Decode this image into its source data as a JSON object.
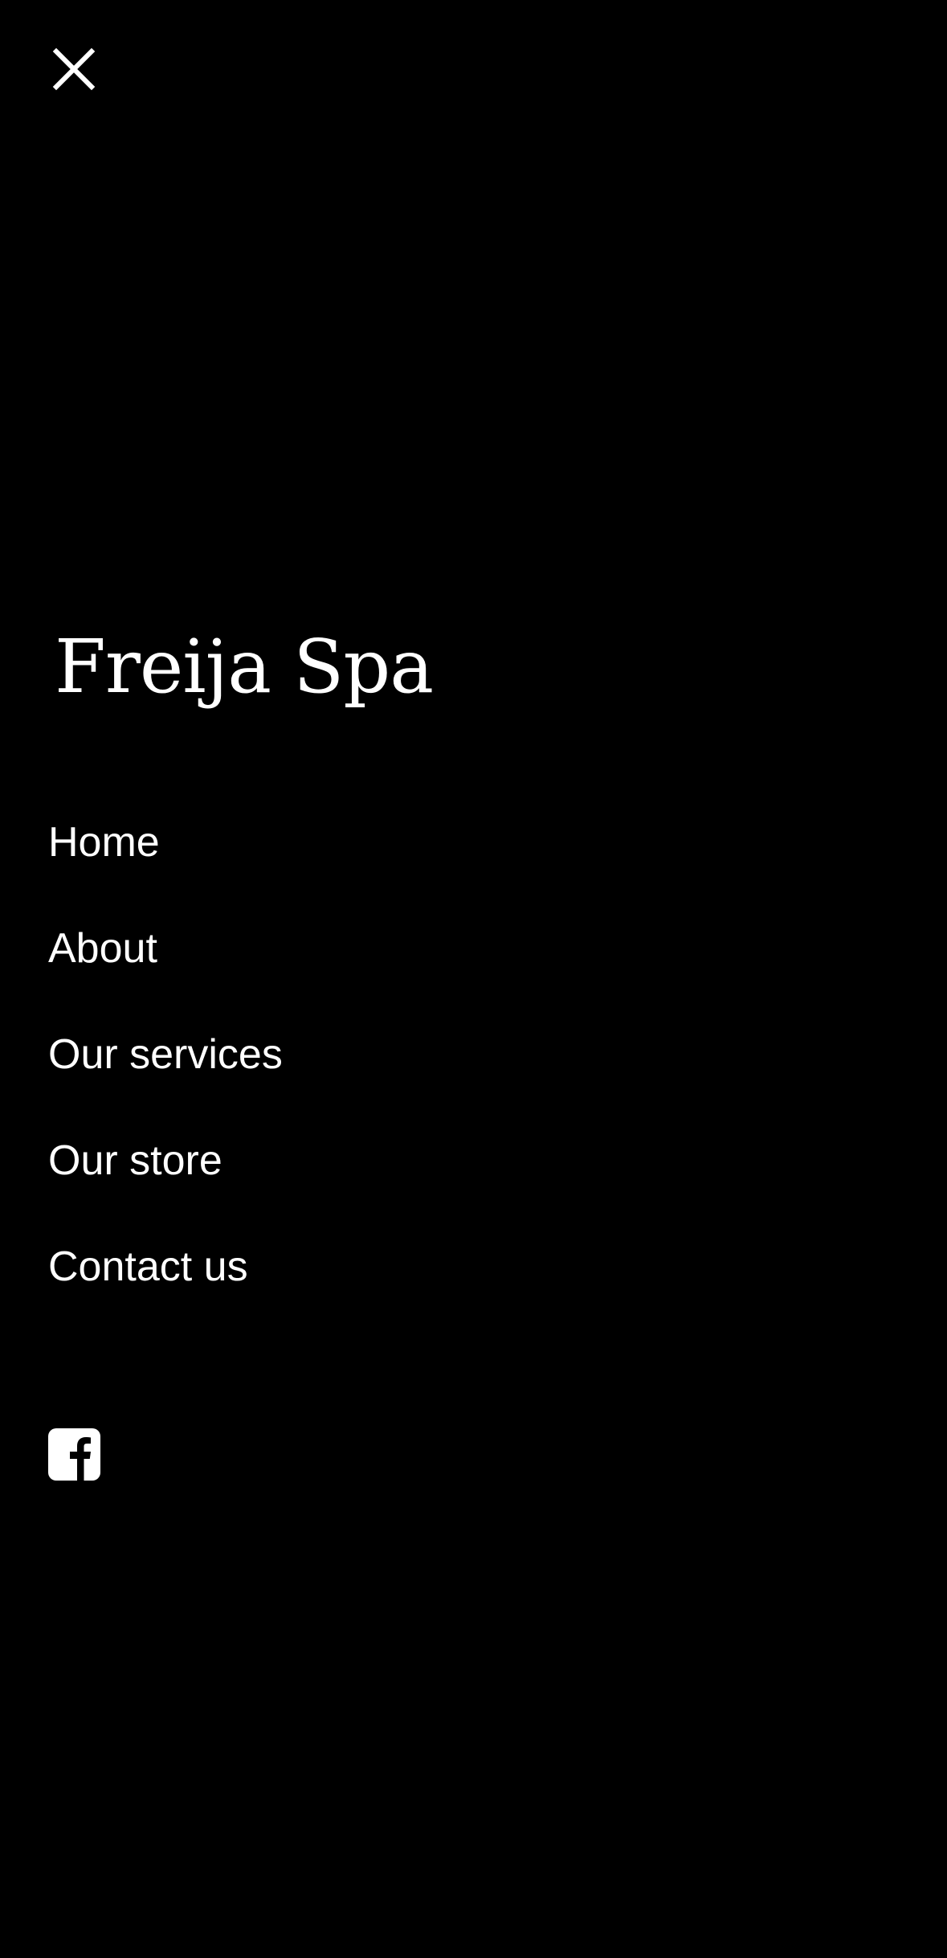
{
  "header": {
    "close_icon": "close-icon"
  },
  "brand": {
    "name": "Freija Spa"
  },
  "nav": {
    "items": [
      {
        "label": "Home"
      },
      {
        "label": "About"
      },
      {
        "label": "Our services"
      },
      {
        "label": "Our store"
      },
      {
        "label": "Contact us"
      }
    ]
  },
  "social": {
    "facebook_icon": "facebook-icon"
  },
  "colors": {
    "background": "#000000",
    "text": "#ffffff"
  }
}
